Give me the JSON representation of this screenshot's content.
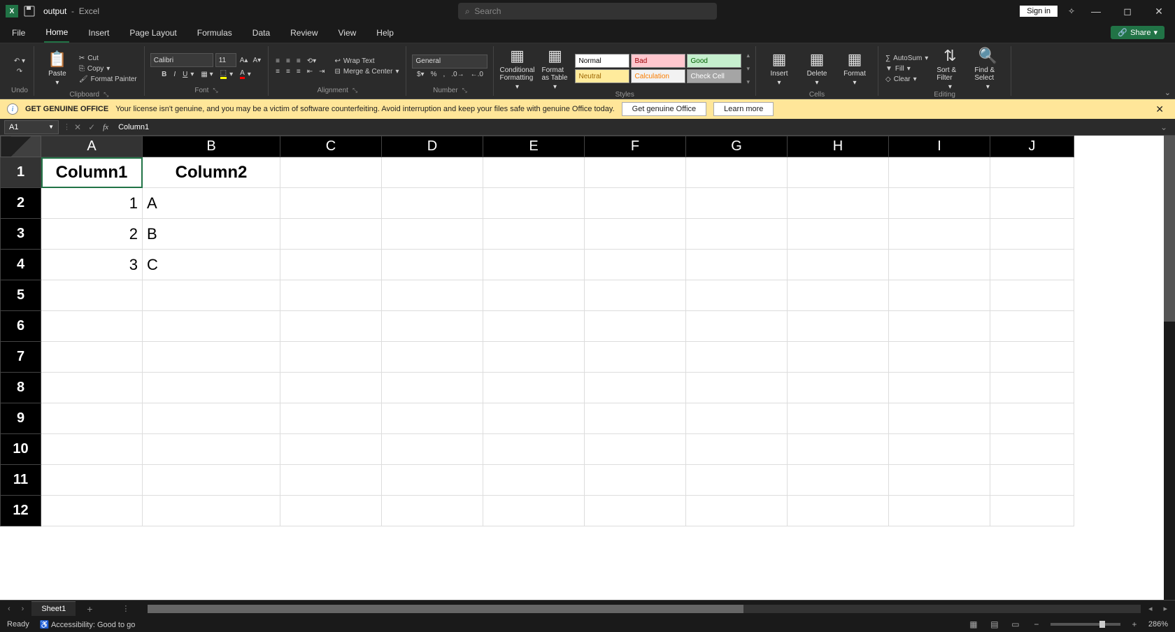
{
  "titlebar": {
    "filename": "output",
    "appname": "Excel",
    "search_placeholder": "Search",
    "signin": "Sign in"
  },
  "tabs": {
    "items": [
      "File",
      "Home",
      "Insert",
      "Page Layout",
      "Formulas",
      "Data",
      "Review",
      "View",
      "Help"
    ],
    "active": "Home",
    "share": "Share"
  },
  "ribbon": {
    "undo_label": "Undo",
    "paste": "Paste",
    "cut": "Cut",
    "copy": "Copy",
    "format_painter": "Format Painter",
    "clipboard_label": "Clipboard",
    "font_name": "Calibri",
    "font_size": "11",
    "font_label": "Font",
    "wrap_text": "Wrap Text",
    "merge_center": "Merge & Center",
    "alignment_label": "Alignment",
    "number_format": "General",
    "number_label": "Number",
    "cond_fmt": "Conditional Formatting",
    "fmt_table": "Format as Table",
    "styles": {
      "normal": "Normal",
      "bad": "Bad",
      "good": "Good",
      "neutral": "Neutral",
      "calc": "Calculation",
      "check": "Check Cell"
    },
    "styles_label": "Styles",
    "insert": "Insert",
    "delete": "Delete",
    "format": "Format",
    "cells_label": "Cells",
    "autosum": "AutoSum",
    "fill": "Fill",
    "clear": "Clear",
    "sort_filter": "Sort & Filter",
    "find_select": "Find & Select",
    "editing_label": "Editing"
  },
  "warning": {
    "title": "GET GENUINE OFFICE",
    "text": "Your license isn't genuine, and you may be a victim of software counterfeiting. Avoid interruption and keep your files safe with genuine Office today.",
    "btn1": "Get genuine Office",
    "btn2": "Learn more"
  },
  "formula": {
    "cellref": "A1",
    "content": "Column1"
  },
  "sheet": {
    "columns": [
      "A",
      "B",
      "C",
      "D",
      "E",
      "F",
      "G",
      "H",
      "I",
      "J"
    ],
    "rows": [
      "1",
      "2",
      "3",
      "4",
      "5",
      "6",
      "7",
      "8",
      "9",
      "10",
      "11",
      "12"
    ],
    "active_cell": "A1",
    "data": {
      "A1": "Column1",
      "B1": "Column2",
      "A2": "1",
      "B2": "A",
      "A3": "2",
      "B3": "B",
      "A4": "3",
      "B4": "C"
    },
    "tab_name": "Sheet1"
  },
  "status": {
    "ready": "Ready",
    "accessibility": "Accessibility: Good to go",
    "zoom": "286%"
  }
}
